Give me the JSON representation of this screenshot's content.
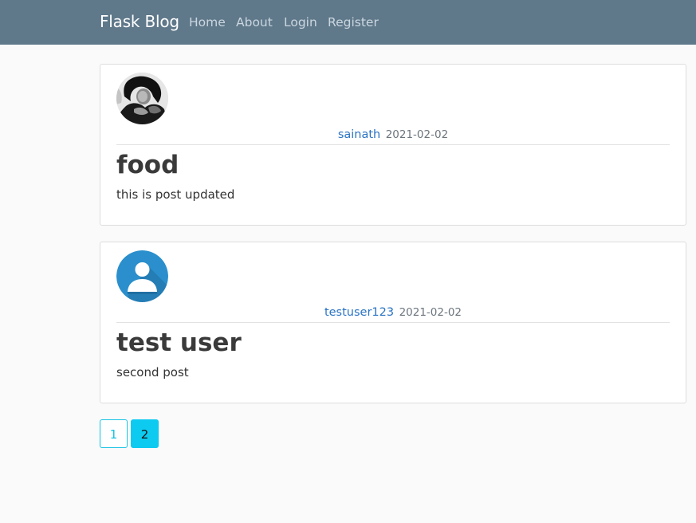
{
  "navbar": {
    "brand": "Flask Blog",
    "links": [
      "Home",
      "About",
      "Login",
      "Register"
    ],
    "background": "#5f788a"
  },
  "posts": [
    {
      "avatar": "user-photo-avatar",
      "author": "sainath",
      "date": "2021-02-02",
      "title": "food",
      "content": "this is post updated"
    },
    {
      "avatar": "default-user-icon",
      "author": "testuser123",
      "date": "2021-02-02",
      "title": "test user",
      "content": "second post"
    }
  ],
  "pagination": {
    "pages": [
      "1",
      "2"
    ],
    "current": "2",
    "accent": "#0dcaf0"
  }
}
